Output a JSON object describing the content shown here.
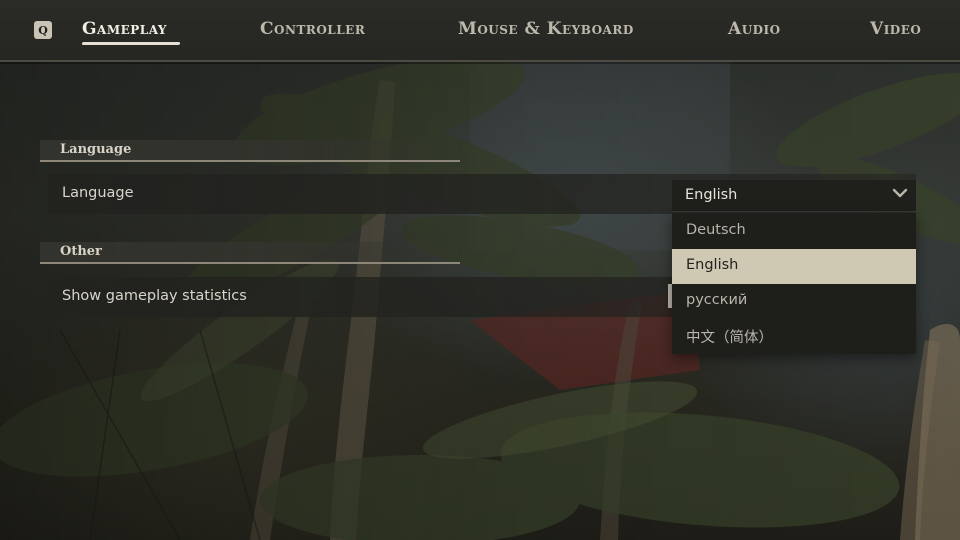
{
  "nav": {
    "key_hint": "Q",
    "tabs": [
      {
        "label": "Gameplay",
        "active": true
      },
      {
        "label": "Controller",
        "active": false
      },
      {
        "label": "Mouse & Keyboard",
        "active": false
      },
      {
        "label": "Audio",
        "active": false
      },
      {
        "label": "Video",
        "active": false
      }
    ]
  },
  "sections": {
    "language": {
      "header": "Language",
      "row_label": "Language",
      "dropdown": {
        "value": "English",
        "icon": "chevron-down-icon",
        "options": [
          "Deutsch",
          "English",
          "русский",
          "中文（简体）"
        ],
        "selected_index": 1
      }
    },
    "other": {
      "header": "Other",
      "row_label": "Show gameplay statistics"
    }
  },
  "colors": {
    "topbar": "#262622",
    "active_tab": "#f2eee4",
    "selected_option": "#cfc8b3",
    "dropdown_bg": "#1e1e1b"
  }
}
